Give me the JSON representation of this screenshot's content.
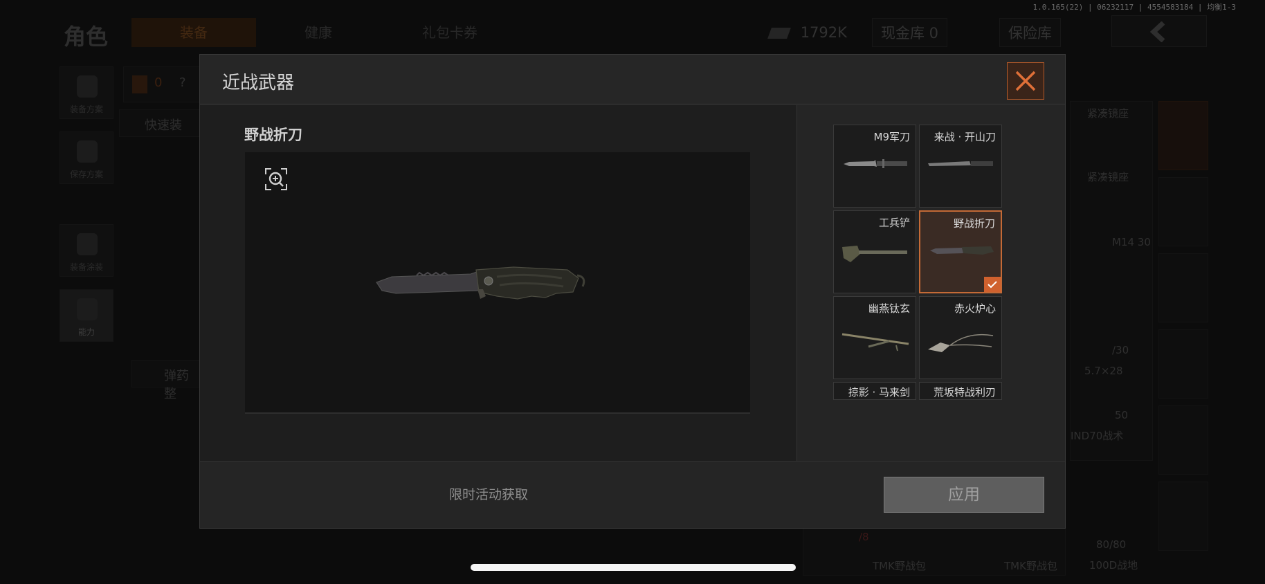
{
  "version_info": "1.0.165(22) | 06232117 | 4554583184 | 均衡1-3",
  "background": {
    "title": "角色",
    "tabs": [
      "装备",
      "健康",
      "礼包卡券"
    ],
    "money": "1792K",
    "cash_vault": "现金库 0",
    "insurance_vault": "保险库",
    "sidebar": [
      "装备方案",
      "保存方案",
      "装备涂装",
      "能力"
    ],
    "quick_label": "快速装",
    "ammo_label": "弹药整",
    "counter": "0",
    "right_items": [
      "紧凑镜座",
      "紧凑镜座",
      "M14 30",
      "/30",
      "5.7×28",
      "50",
      "IND70战术",
      "80/80",
      "TMK野战包",
      "TMK野战包",
      "100D战地",
      "/8"
    ]
  },
  "modal": {
    "title": "近战武器",
    "selected_name": "野战折刀",
    "items": [
      {
        "name": "M9军刀",
        "selected": false
      },
      {
        "name": "来战 · 开山刀",
        "selected": false
      },
      {
        "name": "工兵铲",
        "selected": false
      },
      {
        "name": "野战折刀",
        "selected": true
      },
      {
        "name": "幽燕钛玄",
        "selected": false
      },
      {
        "name": "赤火炉心",
        "selected": false
      },
      {
        "name": "掠影 · 马来剑",
        "selected": false
      },
      {
        "name": "荒坂特战利刃",
        "selected": false
      }
    ],
    "hint": "限时活动获取",
    "apply_label": "应用"
  },
  "colors": {
    "accent_orange": "#d0612e",
    "selected_bg": "#3a2b24",
    "modal_bg": "#1f1f1f"
  },
  "icons": {
    "close": "close-x-icon",
    "zoom": "zoom-in-icon",
    "check": "checkmark-icon"
  }
}
